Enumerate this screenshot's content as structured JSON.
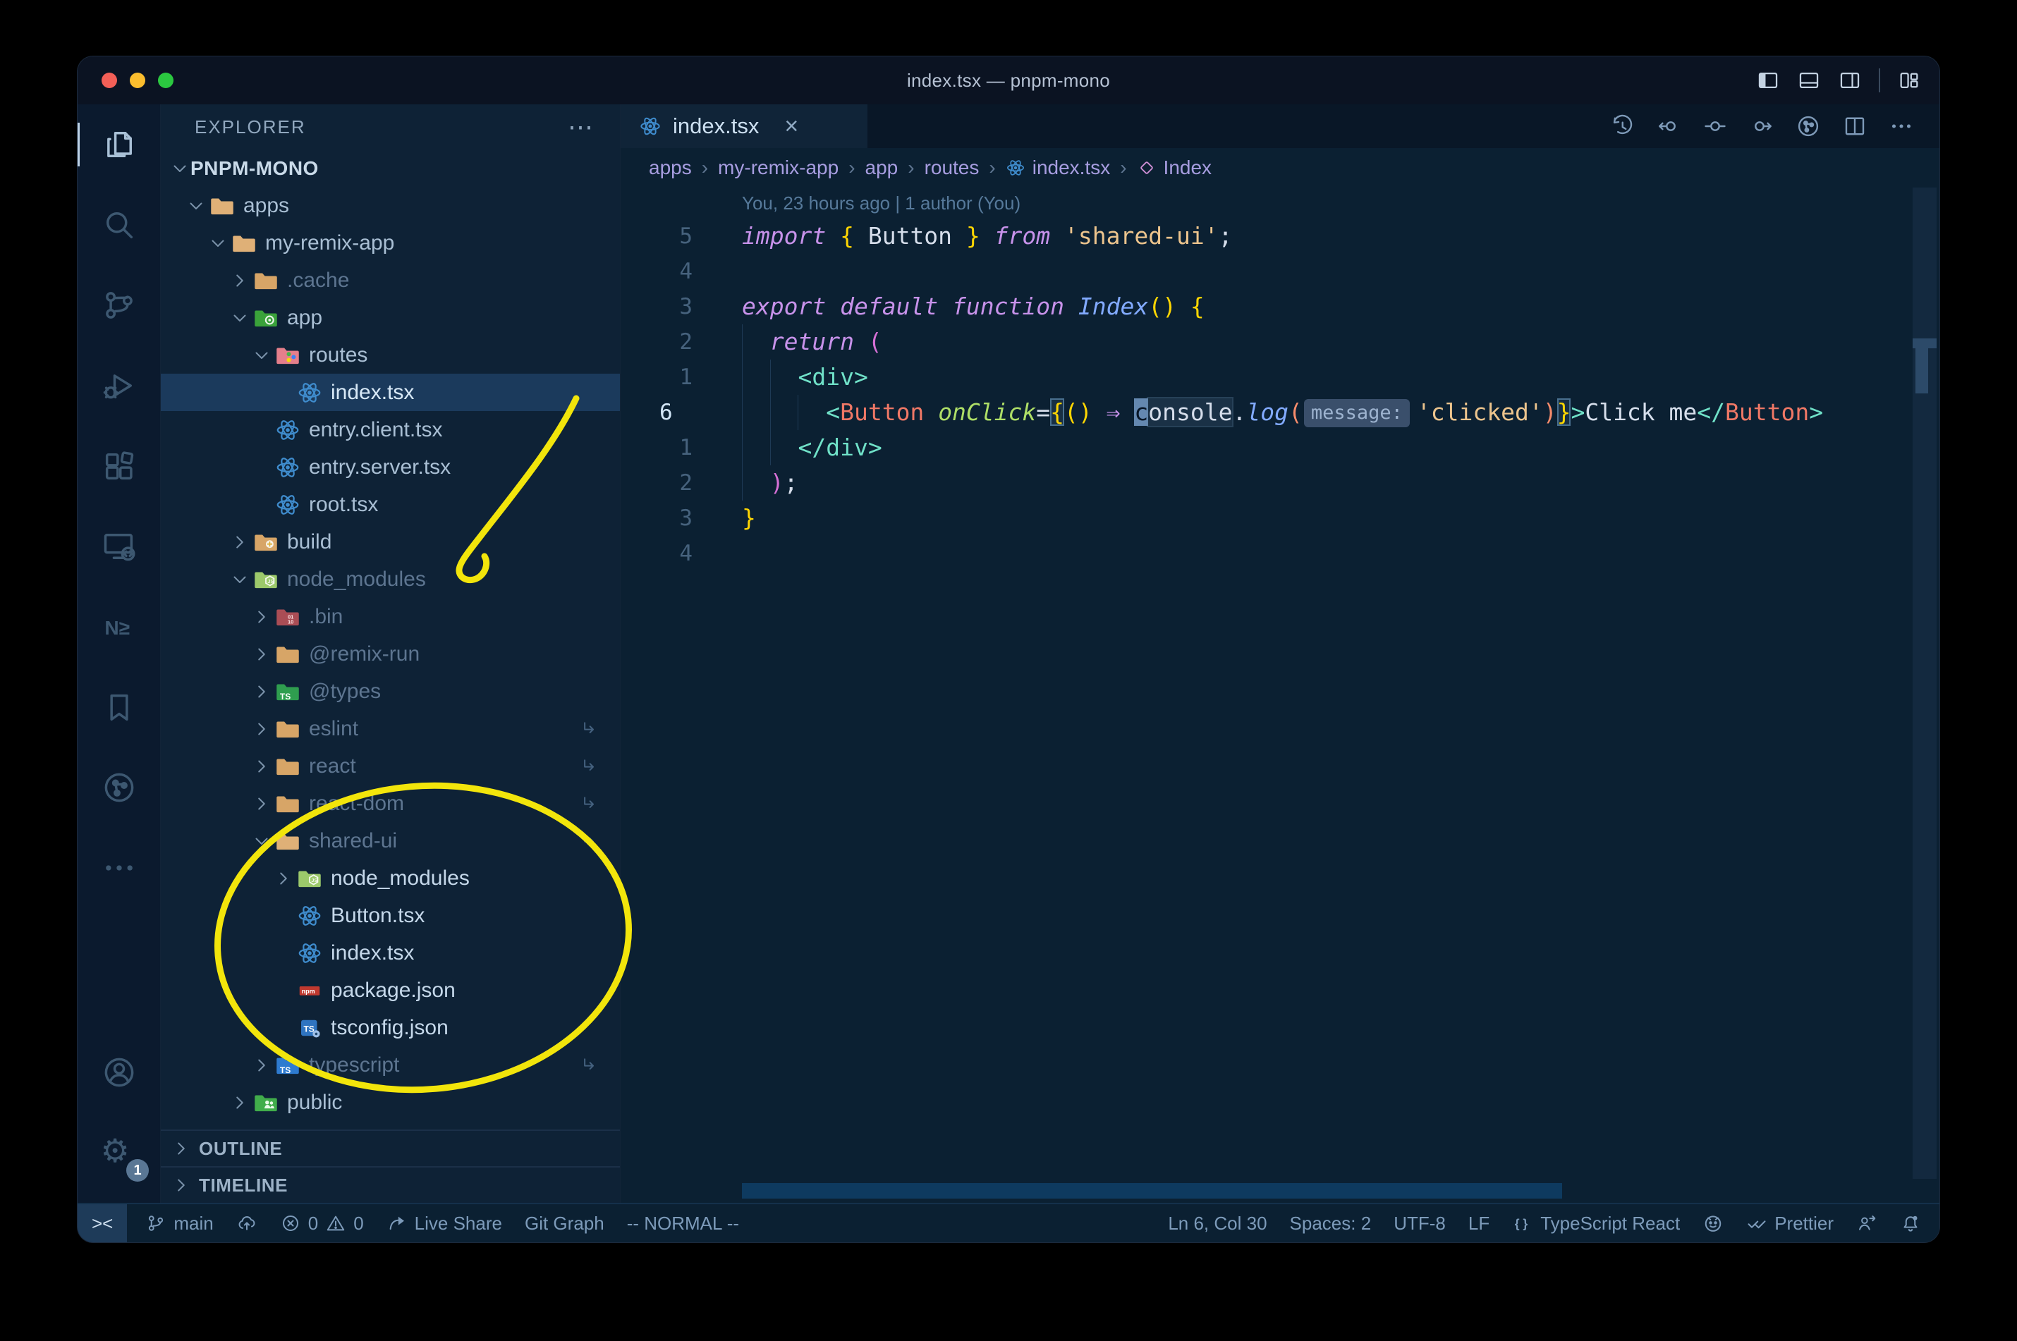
{
  "window": {
    "title": "index.tsx — pnpm-mono"
  },
  "titlebar": {
    "layout_icons": [
      "layout-sidebar-left-icon",
      "layout-panel-icon",
      "layout-sidebar-right-icon",
      "divider",
      "layout-customize-icon"
    ]
  },
  "activity_bar": {
    "top": [
      {
        "name": "explorer",
        "icon": "files-icon",
        "active": true
      },
      {
        "name": "search",
        "icon": "search-icon"
      },
      {
        "name": "source-control",
        "icon": "source-control-icon"
      },
      {
        "name": "run-debug",
        "icon": "debug-icon"
      },
      {
        "name": "extensions",
        "icon": "extensions-icon"
      },
      {
        "name": "remote-explorer",
        "icon": "remote-explorer-icon"
      },
      {
        "name": "nx-console",
        "icon": "nx-icon"
      },
      {
        "name": "bookmarks",
        "icon": "bookmark-icon"
      },
      {
        "name": "git-graph",
        "icon": "git-graph-icon"
      },
      {
        "name": "more-views",
        "icon": "ellipsis-icon"
      }
    ],
    "bottom": [
      {
        "name": "accounts",
        "icon": "account-icon"
      },
      {
        "name": "settings",
        "icon": "gear-icon",
        "badge": "1"
      }
    ]
  },
  "sidebar": {
    "header": "EXPLORER",
    "header_more": "⋯",
    "root": "PNPM-MONO",
    "tree": [
      {
        "label": "apps",
        "level": 1,
        "chevron": "down",
        "icon": "folder-tan-open-icon"
      },
      {
        "label": "my-remix-app",
        "level": 2,
        "chevron": "down",
        "icon": "folder-tan-open-icon"
      },
      {
        "label": ".cache",
        "level": 3,
        "chevron": "right",
        "icon": "folder-tan-icon",
        "dim": true
      },
      {
        "label": "app",
        "level": 3,
        "chevron": "down",
        "icon": "folder-app-icon"
      },
      {
        "label": "routes",
        "level": 4,
        "chevron": "down",
        "icon": "folder-routes-icon"
      },
      {
        "label": "index.tsx",
        "level": 5,
        "icon": "react-icon",
        "selected": true
      },
      {
        "label": "entry.client.tsx",
        "level": 4,
        "icon": "react-icon"
      },
      {
        "label": "entry.server.tsx",
        "level": 4,
        "icon": "react-icon"
      },
      {
        "label": "root.tsx",
        "level": 4,
        "icon": "react-icon"
      },
      {
        "label": "build",
        "level": 3,
        "chevron": "right",
        "icon": "folder-build-icon"
      },
      {
        "label": "node_modules",
        "level": 3,
        "chevron": "down",
        "icon": "folder-nm-icon",
        "dim": true
      },
      {
        "label": ".bin",
        "level": 4,
        "chevron": "right",
        "icon": "folder-bin-icon",
        "dim": true
      },
      {
        "label": "@remix-run",
        "level": 4,
        "chevron": "right",
        "icon": "folder-tan-icon",
        "dim": true
      },
      {
        "label": "@types",
        "level": 4,
        "chevron": "right",
        "icon": "folder-types-icon",
        "dim": true
      },
      {
        "label": "eslint",
        "level": 4,
        "chevron": "right",
        "icon": "folder-tan-icon",
        "dim": true,
        "symlink": true
      },
      {
        "label": "react",
        "level": 4,
        "chevron": "right",
        "icon": "folder-tan-icon",
        "dim": true,
        "symlink": true
      },
      {
        "label": "react-dom",
        "level": 4,
        "chevron": "right",
        "icon": "folder-tan-icon",
        "dim": true,
        "symlink": true
      },
      {
        "label": "shared-ui",
        "level": 4,
        "chevron": "down",
        "icon": "folder-tan-open-icon",
        "dim": true,
        "symlink": true
      },
      {
        "label": "node_modules",
        "level": 5,
        "chevron": "right",
        "icon": "folder-nm-icon",
        "bright": true
      },
      {
        "label": "Button.tsx",
        "level": 5,
        "icon": "react-icon",
        "bright": true
      },
      {
        "label": "index.tsx",
        "level": 5,
        "icon": "react-icon",
        "bright": true
      },
      {
        "label": "package.json",
        "level": 5,
        "icon": "npm-icon",
        "bright": true
      },
      {
        "label": "tsconfig.json",
        "level": 5,
        "icon": "tsconfig-icon",
        "bright": true
      },
      {
        "label": "typescript",
        "level": 4,
        "chevron": "right",
        "icon": "folder-ts-icon",
        "dim": true,
        "symlink": true
      },
      {
        "label": "public",
        "level": 3,
        "chevron": "right",
        "icon": "folder-public-icon"
      }
    ],
    "sections": [
      "OUTLINE",
      "TIMELINE"
    ]
  },
  "editor": {
    "tab": {
      "label": "index.tsx",
      "icon": "react-icon",
      "close": "×"
    },
    "actions": [
      "history-icon",
      "prev-change-icon",
      "change-icon",
      "next-change-icon",
      "git-graph-icon",
      "split-editor-icon",
      "ellipsis-icon"
    ],
    "breadcrumb_separator": "›",
    "breadcrumbs": [
      {
        "label": "apps"
      },
      {
        "label": "my-remix-app"
      },
      {
        "label": "app"
      },
      {
        "label": "routes"
      },
      {
        "label": "index.tsx",
        "icon": "react-icon"
      },
      {
        "label": "Index",
        "icon": "symbol-module-icon"
      }
    ],
    "codelens": "You, 23 hours ago | 1 author (You)",
    "lines": [
      {
        "num": "5",
        "guides": 0,
        "tokens": [
          {
            "t": "import",
            "s": "kw"
          },
          {
            "t": " ",
            "s": "pl"
          },
          {
            "t": "{",
            "s": "by"
          },
          {
            "t": " Button ",
            "s": "pl"
          },
          {
            "t": "}",
            "s": "by"
          },
          {
            "t": " ",
            "s": "pl"
          },
          {
            "t": "from",
            "s": "kw"
          },
          {
            "t": " ",
            "s": "pl"
          },
          {
            "t": "'shared-ui'",
            "s": "str"
          },
          {
            "t": ";",
            "s": "pl"
          }
        ]
      },
      {
        "num": "4",
        "guides": 0,
        "tokens": []
      },
      {
        "num": "3",
        "guides": 0,
        "tokens": [
          {
            "t": "export",
            "s": "kw"
          },
          {
            "t": " ",
            "s": "pl"
          },
          {
            "t": "default",
            "s": "kw"
          },
          {
            "t": " ",
            "s": "pl"
          },
          {
            "t": "function",
            "s": "kw"
          },
          {
            "t": " ",
            "s": "pl"
          },
          {
            "t": "Index",
            "s": "fn"
          },
          {
            "t": "()",
            "s": "by"
          },
          {
            "t": " ",
            "s": "pl"
          },
          {
            "t": "{",
            "s": "by"
          }
        ]
      },
      {
        "num": "2",
        "guides": 1,
        "tokens": [
          {
            "t": "  ",
            "s": "pl"
          },
          {
            "t": "return",
            "s": "kw"
          },
          {
            "t": " ",
            "s": "pl"
          },
          {
            "t": "(",
            "s": "pp"
          }
        ]
      },
      {
        "num": "1",
        "guides": 2,
        "tokens": [
          {
            "t": "    ",
            "s": "pl"
          },
          {
            "t": "<div>",
            "s": "tag"
          }
        ]
      },
      {
        "num": "6",
        "active": true,
        "guides": 3,
        "tokens": [
          {
            "t": "      ",
            "s": "pl"
          },
          {
            "t": "<",
            "s": "tag"
          },
          {
            "t": "Button",
            "s": "comp"
          },
          {
            "t": " ",
            "s": "pl"
          },
          {
            "t": "onClick",
            "s": "attr"
          },
          {
            "t": "=",
            "s": "pl"
          },
          {
            "t": "{",
            "s": "by",
            "f": "match"
          },
          {
            "t": "()",
            "s": "by"
          },
          {
            "t": " ",
            "s": "pl"
          },
          {
            "t": "⇒",
            "s": "arrow"
          },
          {
            "t": " ",
            "s": "pl"
          },
          {
            "t": "c",
            "s": "pl",
            "f": "cursor"
          },
          {
            "t": "onsole",
            "s": "pl",
            "f": "whl"
          },
          {
            "t": ".",
            "s": "pl"
          },
          {
            "t": "log",
            "s": "fn"
          },
          {
            "t": "(",
            "s": "po"
          },
          {
            "t": "message:",
            "s": "hint",
            "f": "hint"
          },
          {
            "t": "'clicked'",
            "s": "str"
          },
          {
            "t": ")",
            "s": "po"
          },
          {
            "t": "}",
            "s": "by",
            "f": "match"
          },
          {
            "t": ">",
            "s": "tag"
          },
          {
            "t": "Click me",
            "s": "pl"
          },
          {
            "t": "</",
            "s": "tag"
          },
          {
            "t": "Button",
            "s": "comp"
          },
          {
            "t": ">",
            "s": "tag"
          }
        ]
      },
      {
        "num": "1",
        "guides": 2,
        "tokens": [
          {
            "t": "    ",
            "s": "pl"
          },
          {
            "t": "</div>",
            "s": "tag"
          }
        ]
      },
      {
        "num": "2",
        "guides": 1,
        "tokens": [
          {
            "t": "  ",
            "s": "pl"
          },
          {
            "t": ")",
            "s": "pp"
          },
          {
            "t": ";",
            "s": "pl"
          }
        ]
      },
      {
        "num": "3",
        "guides": 0,
        "tokens": [
          {
            "t": "}",
            "s": "by"
          }
        ]
      },
      {
        "num": "4",
        "guides": 0,
        "tokens": []
      }
    ]
  },
  "status_bar": {
    "left": [
      {
        "name": "remote-indicator",
        "label": "><",
        "style": "remote"
      },
      {
        "name": "git-branch",
        "icon": "git-branch-icon",
        "label": "main"
      },
      {
        "name": "sync-changes",
        "icon": "cloud-upload-icon"
      },
      {
        "name": "problems",
        "icon": "error-icon",
        "label": "0",
        "icon2": "warning-icon",
        "label2": "0"
      },
      {
        "name": "live-share",
        "icon": "share-icon",
        "label": "Live Share"
      },
      {
        "name": "git-graph",
        "label": "Git Graph"
      },
      {
        "name": "vim-mode",
        "label": "-- NORMAL --"
      }
    ],
    "right": [
      {
        "name": "cursor-position",
        "label": "Ln 6, Col 30"
      },
      {
        "name": "indentation",
        "label": "Spaces: 2"
      },
      {
        "name": "encoding",
        "label": "UTF-8"
      },
      {
        "name": "eol",
        "label": "LF"
      },
      {
        "name": "language-mode",
        "icon": "braces-icon",
        "label": "TypeScript React"
      },
      {
        "name": "github",
        "icon": "github-icon"
      },
      {
        "name": "prettier",
        "icon": "double-check-icon",
        "label": "Prettier"
      },
      {
        "name": "feedback",
        "icon": "person-feedback-icon"
      },
      {
        "name": "notifications",
        "icon": "bell-icon"
      }
    ]
  },
  "annotations": {
    "arrow": "hand-drawn yellow arrow pointing at node_modules",
    "ellipse": "hand-drawn yellow ellipse around shared-ui package contents",
    "color": "#f2e50b"
  },
  "colors": {
    "editor_background": "#0b2032",
    "sidebar_background": "#0e2236",
    "selection_row": "#1b3a5c",
    "keyword": "#c792ea",
    "string": "#ecc48d",
    "tag": "#70e1c8",
    "component": "#f07866",
    "bracket_yellow": "#ffd602",
    "annotation_yellow": "#f2e50b"
  }
}
